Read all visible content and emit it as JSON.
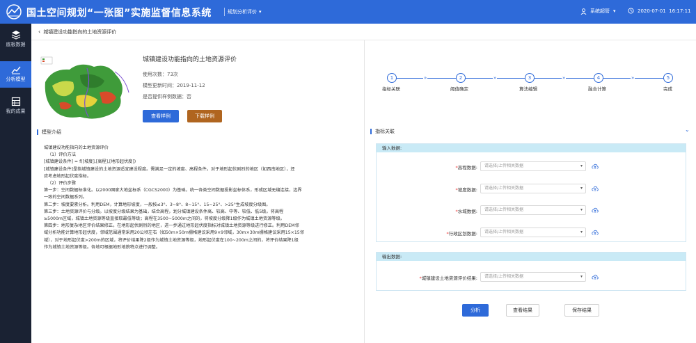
{
  "header": {
    "app_title": "国土空间规划“一张图”实施监督信息系统",
    "module_label": "规划分析评价",
    "user_label": "系统超管",
    "datetime": "2020-07-01  16:17:11"
  },
  "sidebar": {
    "items": [
      {
        "label": "底板数据",
        "icon": "layers-icon"
      },
      {
        "label": "分析模型",
        "icon": "chart-icon",
        "active": true
      },
      {
        "label": "我的成果",
        "icon": "grid-icon"
      }
    ]
  },
  "breadcrumb": {
    "label": "城镇建设功能指向的土地资源评价"
  },
  "model": {
    "title": "城镇建设功能指向的土地资源评价",
    "usage": "使用次数：73次",
    "updated": "模型更新时间：2019-11-12",
    "sample": "是否提供样例数据：否",
    "view_sample_label": "查看样例",
    "download_sample_label": "下载样例"
  },
  "intro": {
    "heading": "模型介绍",
    "lines": [
      "城镇建设功能指向的土地资源评价",
      "（1）评价方法",
      "[城镇建设条件] = f([坡度],[高程],[地形起伏度])",
      "[城镇建设条件]是指城镇建设的土地资源适宜建设程度。需满足一定的坡度、高程条件。对于地形起伏剧烈的地区（如西南地区），还",
      "应考虑地形起伏度指标。",
      "（2）评价步骤",
      "第一步：空间数据标准化。以2000国家大地坐标系（CGCS2000）为基础，统一各类空间数据投影坐标体系，形成区域无缝连接，边界",
      "一致的空间数据系列。",
      "第二步：坡度要素分析。利用DEM，计算地形坡度，一般按≤3°、3~8°、8~15°、15~25°、>25°生成坡度分级图。",
      "第三步：土地资源评价与分级。以坡度分级结果为基础，结合高程，划分城镇建设条件高、较高、中等、较低、低5级。将高程",
      "≥5000m区域，城镇土地资源等级直接取最低等级；高程在3500~5000m之间的，将坡度分级降1级作为城镇土地资源等级。",
      "第四步：地形复杂地区评价结果修正。在地形起伏剧烈的地区，进一步通过地形起伏度指标对城镇土地资源等级进行修正。利用DEM邻",
      "域分析功能计算地形起伏度，邻域范围通常采用20公顷左右（如50m×50m栅格建议采用9×9邻域，30m×30m栅格建议采用15×15邻",
      "域），对于地形起伏度>200m的区域，将评价结果降2级作为城镇土地资源等级，地形起伏度在100~200m之间的，将评价结果降1级",
      "作为城镇土地资源等级。各地可根据地形地貌特点进行调整。"
    ]
  },
  "steps": [
    {
      "number": "1",
      "label": "指标关联"
    },
    {
      "number": "2",
      "label": "阈值确定"
    },
    {
      "number": "3",
      "label": "算法编辑"
    },
    {
      "number": "4",
      "label": "融合计算"
    },
    {
      "number": "5",
      "label": "完成"
    }
  ],
  "indicator": {
    "heading": "指标关联",
    "input_head": "输入数据:",
    "output_head": "输出数据:",
    "inputs": [
      {
        "label": "高程数据:",
        "placeholder": "请选择/上传相关数据"
      },
      {
        "label": "坡度数据:",
        "placeholder": "请选择/上传相关数据"
      },
      {
        "label": "水域数据:",
        "placeholder": "请选择/上传相关数据"
      },
      {
        "label": "行政区划数据:",
        "placeholder": "请选择/上传相关数据"
      }
    ],
    "output": {
      "label": "城镇建设土地资源评价结果:",
      "placeholder": "请选择/上传相关数据"
    }
  },
  "actions": {
    "analyze_label": "分析",
    "view_result_label": "查看结果",
    "save_result_label": "保存结果"
  },
  "colors": {
    "accent": "#2e6ad9",
    "sidebar": "#1a2233",
    "download": "#b0651f",
    "panel_head": "#c9eaf6"
  }
}
